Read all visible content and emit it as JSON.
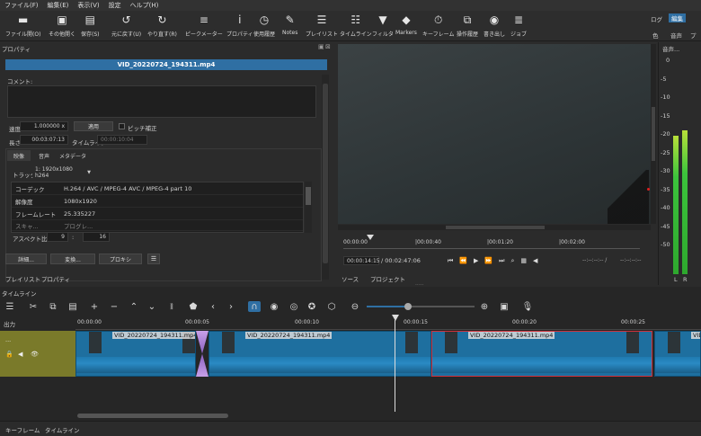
{
  "menu": [
    "ファイル(F)",
    "編集(E)",
    "表示(V)",
    "設定",
    "ヘルプ(H)"
  ],
  "toolbar": [
    {
      "label": "ファイル開(O)",
      "icon": "folder-open-icon",
      "glyph": "▬"
    },
    {
      "label": "その他開く",
      "icon": "open-other-icon",
      "glyph": "▣"
    },
    {
      "label": "保存(S)",
      "icon": "save-icon",
      "glyph": "▤"
    },
    {
      "label": "元に戻す(U)",
      "icon": "undo-icon",
      "glyph": "↺"
    },
    {
      "label": "やり直す(R)",
      "icon": "redo-icon",
      "glyph": "↻"
    },
    {
      "label": "ピークメーター",
      "icon": "peak-meter-icon",
      "glyph": "≡"
    },
    {
      "label": "プロパティ",
      "icon": "properties-icon",
      "glyph": "i"
    },
    {
      "label": "使用履歴",
      "icon": "history-icon",
      "glyph": "◷"
    },
    {
      "label": "Notes",
      "icon": "notes-icon",
      "glyph": "✎"
    },
    {
      "label": "プレイリスト",
      "icon": "playlist-icon",
      "glyph": "☰"
    },
    {
      "label": "タイムライン",
      "icon": "timeline-icon",
      "glyph": "☷"
    },
    {
      "label": "フィルタ",
      "icon": "filter-icon",
      "glyph": "▼"
    },
    {
      "label": "Markers",
      "icon": "markers-icon",
      "glyph": "◆"
    },
    {
      "label": "キーフレーム",
      "icon": "keyframe-icon",
      "glyph": "⏱"
    },
    {
      "label": "操作履歴",
      "icon": "job-history-icon",
      "glyph": "⧉"
    },
    {
      "label": "書き出し",
      "icon": "export-icon",
      "glyph": "◉"
    },
    {
      "label": "ジョブ",
      "icon": "jobs-icon",
      "glyph": "≣"
    }
  ],
  "layout_switcher": {
    "log": "ログ",
    "edit": "編集",
    "color": "色",
    "audio": "音声",
    "play": "プレ"
  },
  "properties": {
    "title": "プロパティ",
    "filename": "VID_20220724_194311.mp4",
    "comment_label": "コメント:",
    "speed_label": "速度",
    "speed_value": "1.000000 x",
    "apply_label": "適用",
    "pitch_label": "ピッチ補正",
    "length_label": "長さ",
    "length_value": "00:03:07:13",
    "timeline_label": "タイムライン",
    "timeline_value": "00:00:10:04",
    "tabs": [
      "映像",
      "音声",
      "メタデータ"
    ],
    "track_label": "トラック",
    "track_value": "1: 1920x1080 h264",
    "rows": [
      {
        "k": "コーデック",
        "v": "H.264 / AVC / MPEG-4 AVC / MPEG-4 part 10"
      },
      {
        "k": "解像度",
        "v": "1080x1920"
      },
      {
        "k": "フレームレート",
        "v": "25.335227"
      },
      {
        "k": "スキャ...",
        "v": "プログレ..."
      }
    ],
    "aspect_label": "アスペクト比",
    "aspect_w": "9",
    "aspect_h": "16",
    "bottom_buttons": [
      "詳細...",
      "変換...",
      "プロキシ"
    ],
    "bottom_tabs": [
      "プレイリスト",
      "プロパティ"
    ]
  },
  "player": {
    "timecode_start": "00:00:00",
    "ticks": [
      "00:00:00",
      "|00:00:40",
      "|00:01:20",
      "|00:02:00"
    ],
    "position": "00:00:14:15",
    "duration": "/ 00:02:47:06",
    "in_point": "--:--:--:-- /",
    "out_point": "--:--:--:--",
    "tabs": [
      "ソース",
      "プロジェクト"
    ]
  },
  "audio_meter": {
    "title": "音声...",
    "scale": [
      "0",
      "-5",
      "-10",
      "-15",
      "-20",
      "-25",
      "-30",
      "-35",
      "-40",
      "-45",
      "-50"
    ],
    "channels": [
      "L",
      "R"
    ]
  },
  "timeline": {
    "title": "タイムライン",
    "output_label": "出力",
    "track_name": "...",
    "ruler": [
      "00:00:00",
      "00:00:05",
      "00:00:10",
      "00:00:15",
      "00:00:20",
      "00:00:25"
    ],
    "clips": [
      "VID_20220724_194311.mp4",
      "VID_20220724_194311.mp4",
      "VID_20220724_194311.mp4",
      "VID"
    ],
    "bottom_tabs": [
      "キーフレーム",
      "タイムライン"
    ]
  },
  "colors": {
    "accent": "#2f6fa3",
    "clip": "#1e6f9f",
    "selected": "#d0303a",
    "meter": "#3cc43c"
  }
}
